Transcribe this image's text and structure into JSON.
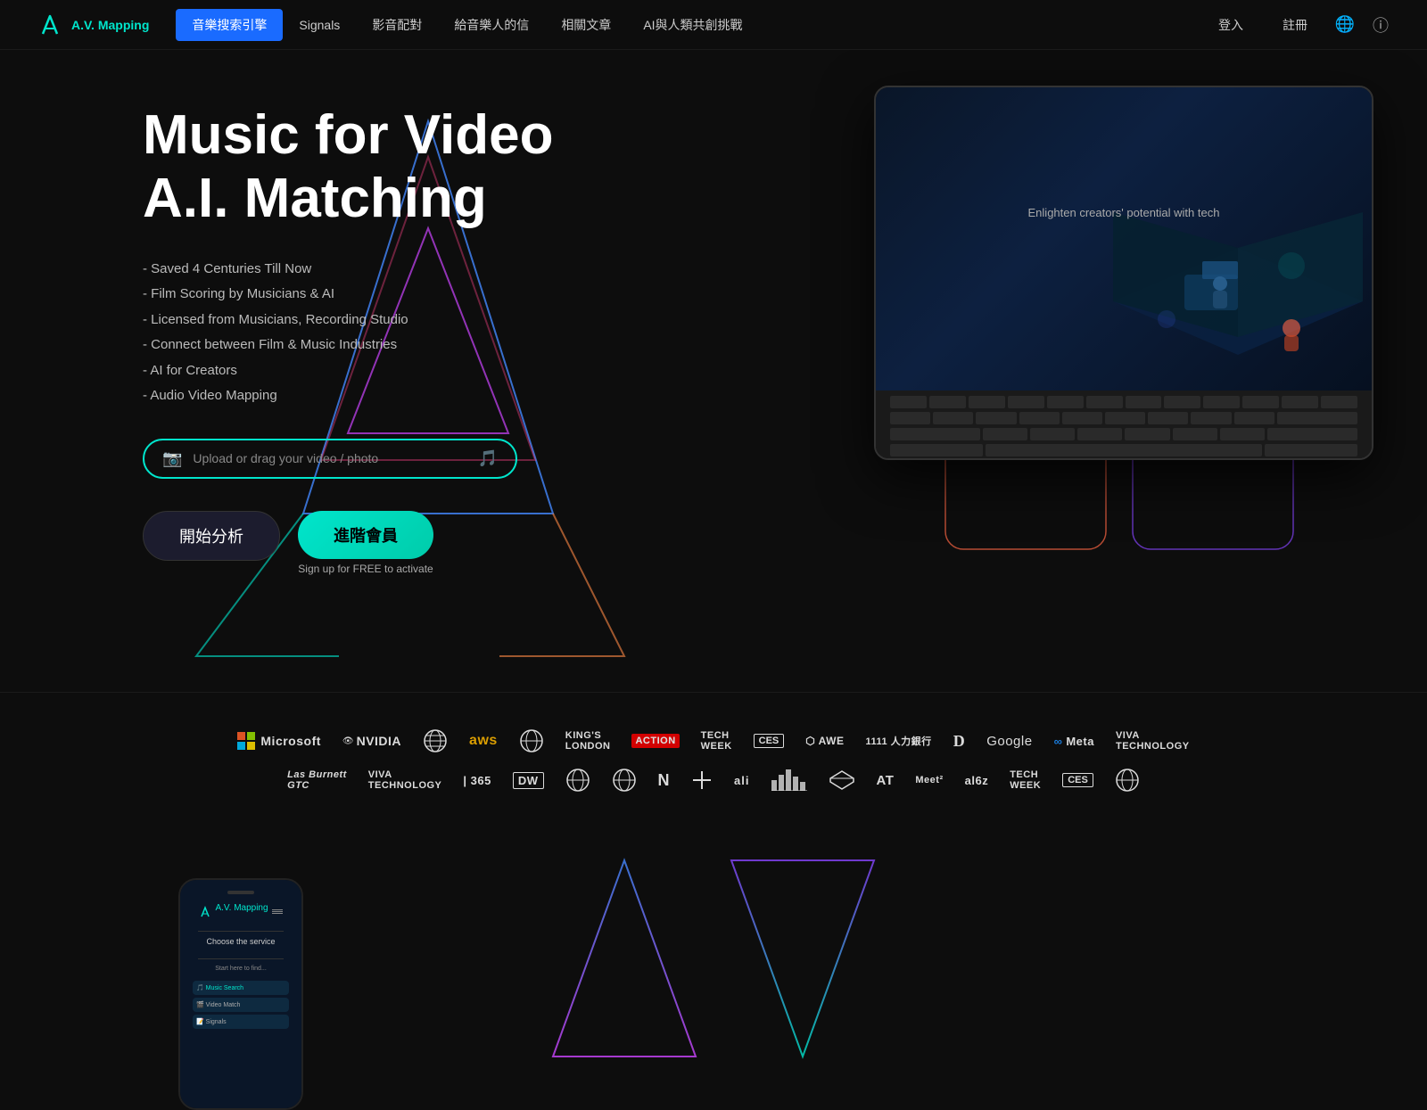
{
  "nav": {
    "logo_text": "A.V. Mapping",
    "items": [
      {
        "label": "音樂搜索引擎",
        "active": true
      },
      {
        "label": "Signals",
        "active": false
      },
      {
        "label": "影音配對",
        "active": false
      },
      {
        "label": "給音樂人的信",
        "active": false
      },
      {
        "label": "相關文章",
        "active": false
      },
      {
        "label": "AI與人類共創挑戰",
        "active": false
      },
      {
        "label": "登入",
        "active": false
      },
      {
        "label": "註冊",
        "active": false
      }
    ]
  },
  "hero": {
    "title_line1": "Music for Video",
    "title_line2": "A.I. Matching",
    "features": [
      "- Saved 4 Centuries Till Now",
      "- Film Scoring by Musicians & AI",
      "- Licensed from Musicians, Recording Studio",
      "- Connect between Film & Music Industries",
      "- AI for Creators",
      "- Audio Video Mapping"
    ],
    "upload_placeholder": "Upload or drag your video / photo",
    "btn_start": "開始分析",
    "btn_upgrade": "進階會員",
    "btn_upgrade_sub": "Sign up for FREE to activate",
    "tablet_caption": "Enlighten creators' potential with tech"
  },
  "partners": {
    "row1": [
      "Microsoft",
      "NVIDIA",
      "UN",
      "aws",
      "United Nations",
      "King's London",
      "Action Week",
      "Tech Week",
      "CES",
      "AWE",
      "1111 人力銀行",
      "D",
      "Google",
      "∞ Meta",
      "VIVA TECHNOLOGY"
    ],
    "row2": [
      "Las Burnett GTC",
      "VIVA TECHNOLOGY",
      "| 365",
      "DW",
      "⊕",
      "⊕",
      "N",
      "⊕",
      "ali",
      "⊕",
      "⊕",
      "AT",
      "Meet²",
      "al6z",
      "Tech Week",
      "CES",
      "⊕"
    ]
  },
  "bottom": {
    "phone1_title": "A.V. Mapping",
    "phone1_subtitle": "Choose the service",
    "phone1_text": "Start here to find..."
  },
  "icons": {
    "camera": "📷",
    "music": "🎵",
    "globe": "🌐",
    "question": "ⓘ"
  }
}
